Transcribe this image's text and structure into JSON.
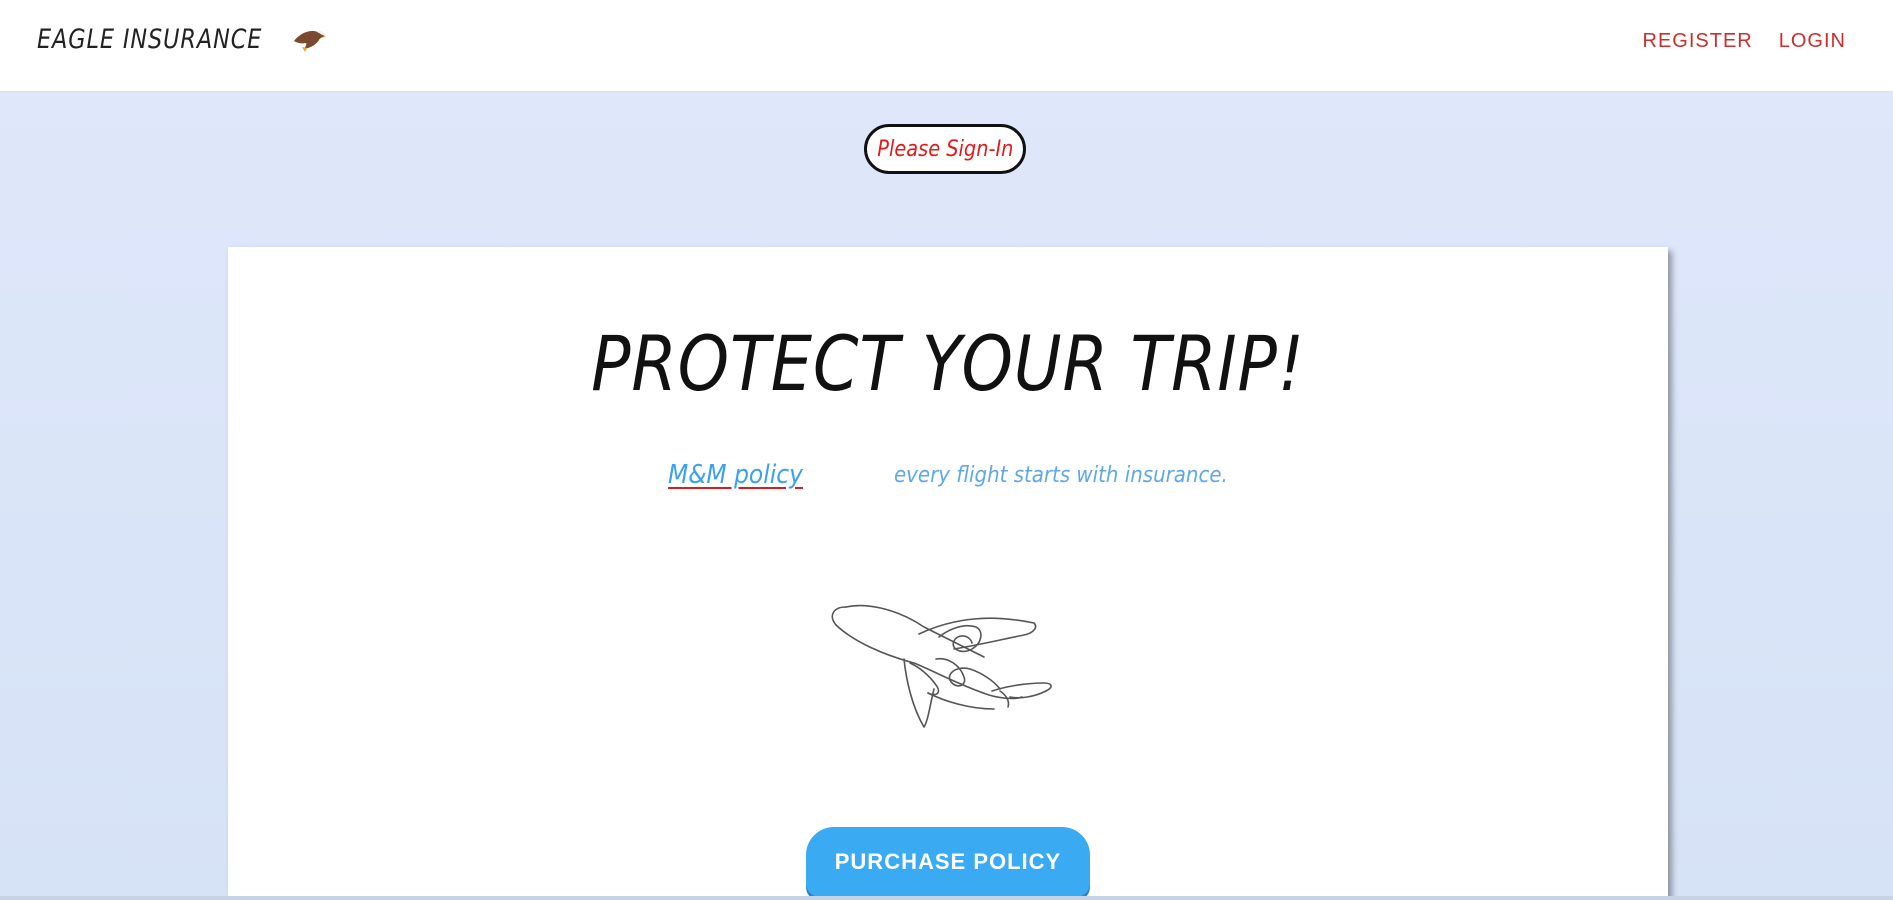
{
  "navbar": {
    "brand": "EAGLE INSURANCE",
    "brand_icon": "eagle-icon",
    "links": {
      "register": "REGISTER",
      "login": "LOGIN"
    }
  },
  "notice": {
    "signin": "Please Sign-In"
  },
  "hero": {
    "headline": "PROTECT YOUR TRIP!",
    "policy_link": "M&M policy",
    "tagline": "every flight starts with insurance.",
    "illustration": "airplane-line-drawing",
    "purchase_button": "PURCHASE POLICY"
  },
  "colors": {
    "accent_red": "#c9302c",
    "button_blue": "#3aabf2",
    "link_blue": "#3aa0ef",
    "background": "#e0e8fb"
  }
}
